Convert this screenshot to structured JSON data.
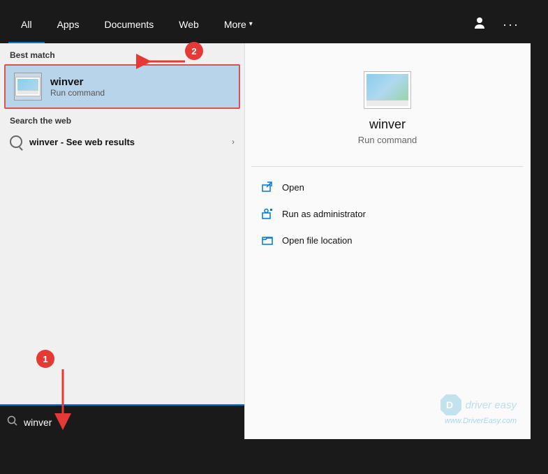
{
  "nav": {
    "tabs": [
      {
        "id": "all",
        "label": "All",
        "active": true
      },
      {
        "id": "apps",
        "label": "Apps",
        "active": false
      },
      {
        "id": "documents",
        "label": "Documents",
        "active": false
      },
      {
        "id": "web",
        "label": "Web",
        "active": false
      },
      {
        "id": "more",
        "label": "More",
        "active": false,
        "hasChevron": true
      }
    ],
    "icons": {
      "person": "👤",
      "ellipsis": "···"
    }
  },
  "left_panel": {
    "best_match": {
      "section_label": "Best match",
      "item": {
        "name": "winver",
        "subtitle": "Run command"
      }
    },
    "search_web": {
      "section_label": "Search the web",
      "item_text": "winver",
      "item_suffix": "- See web results"
    }
  },
  "right_panel": {
    "app_name": "winver",
    "app_subtitle": "Run command",
    "actions": [
      {
        "id": "open",
        "label": "Open"
      },
      {
        "id": "run-as-admin",
        "label": "Run as administrator"
      },
      {
        "id": "open-file-location",
        "label": "Open file location"
      }
    ]
  },
  "search_bar": {
    "placeholder": "winver",
    "value": "winver",
    "icon": "🔍"
  },
  "annotations": {
    "badge1": "1",
    "badge2": "2"
  },
  "watermark": {
    "brand": "driver easy",
    "url": "www.DriverEasy.com"
  }
}
